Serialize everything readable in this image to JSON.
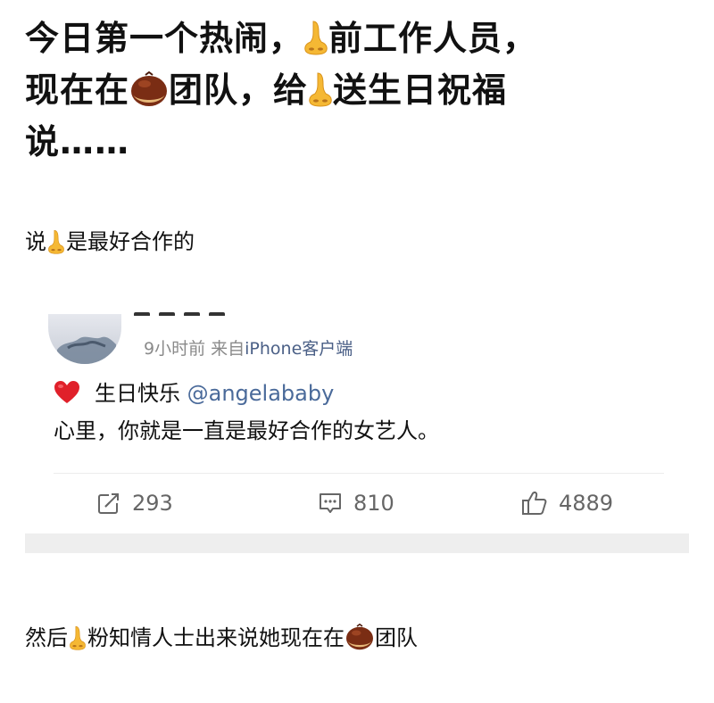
{
  "headline": {
    "part1": "今日第一个热闹，",
    "part2": "前工作人员，",
    "part3": "现在在",
    "part4": "团队，给",
    "part5": "送生日祝福",
    "part6": "说……"
  },
  "para1": {
    "pre": "说",
    "post": "是最好合作的"
  },
  "post": {
    "meta_time": "9小时前",
    "meta_from": "来自",
    "meta_source": "iPhone客户端",
    "birthday_text": "生日快乐",
    "mention": "@angelababy",
    "message": "心里，你就是一直是最好合作的女艺人。",
    "stats": {
      "reposts": "293",
      "comments": "810",
      "likes": "4889"
    }
  },
  "para2": {
    "pre": "然后",
    "mid": "粉知情人士出来说她现在在",
    "post": "团队"
  },
  "icons": [
    "nose-emoji",
    "chestnut-emoji",
    "heart-emoji",
    "repost-icon",
    "comment-icon",
    "like-icon"
  ],
  "colors": {
    "text": "#111111",
    "meta": "#8a8a8a",
    "link": "#4a6a9a",
    "divider": "#eeeeee"
  }
}
